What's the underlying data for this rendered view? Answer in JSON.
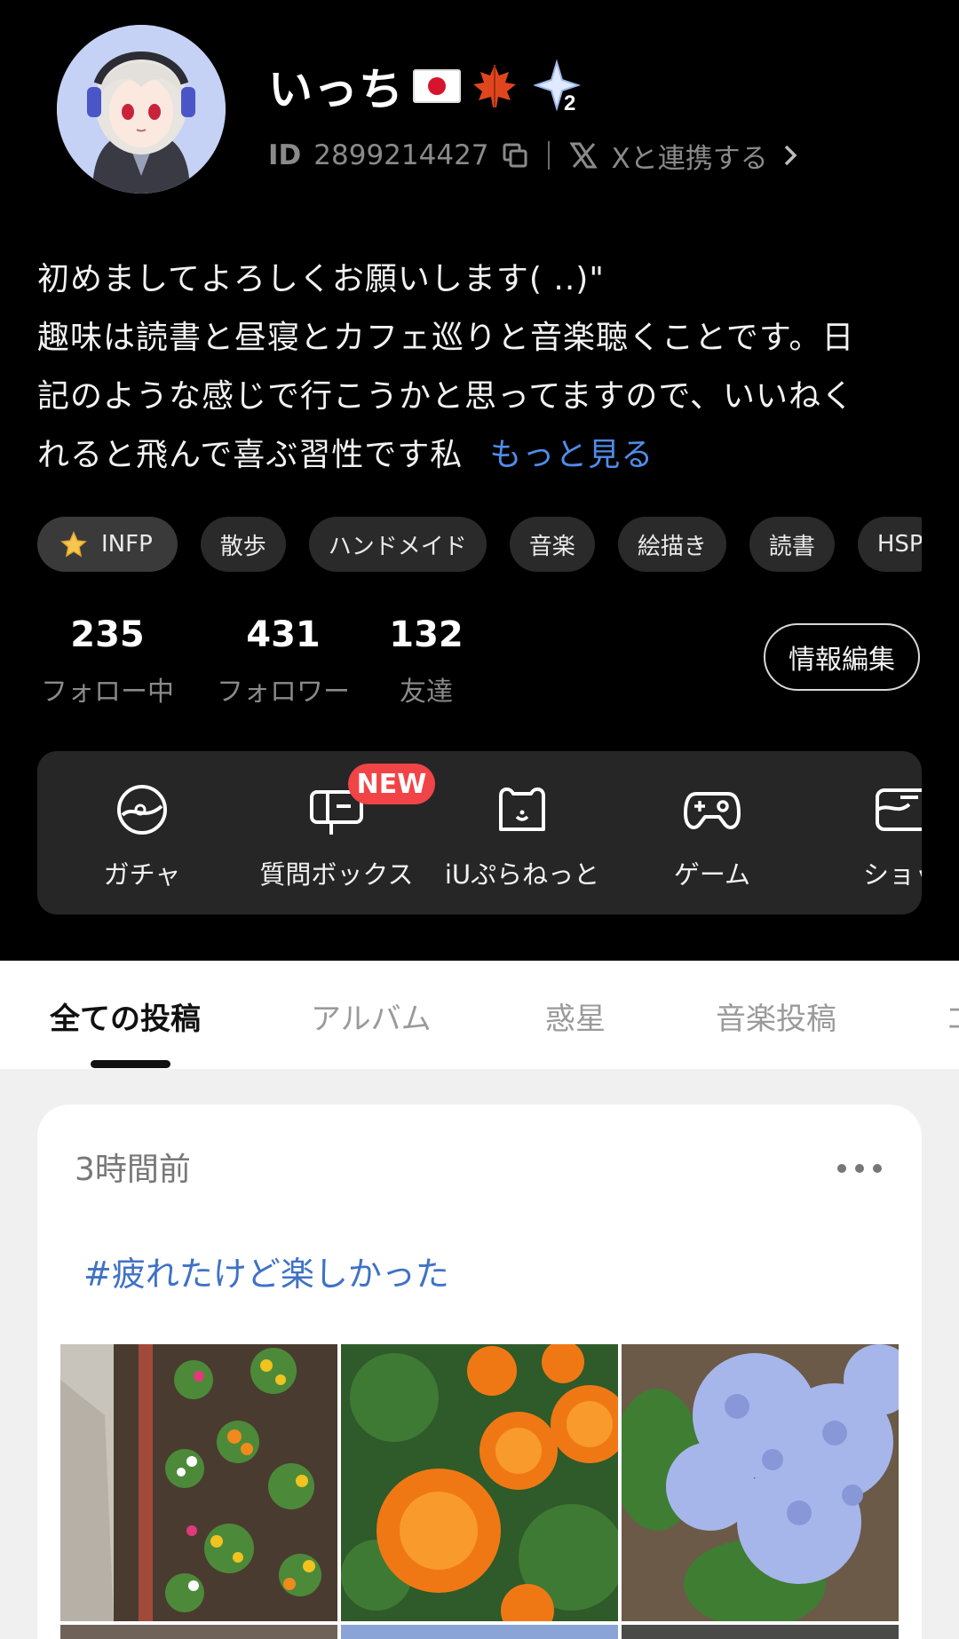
{
  "profile": {
    "username": "いっち",
    "id_label": "ID",
    "id_value": "2899214427",
    "x_link_label": "Xと連携する",
    "badge_level": "2",
    "bio_lines": [
      "初めましてよろしくお願いします( ..)\"",
      "趣味は読書と昼寝とカフェ巡りと音楽聴くことです。日",
      "記のような感じで行こうかと思ってますので、いいねく",
      "れると飛んで喜ぶ習性です私"
    ],
    "bio_more": "もっと見る"
  },
  "tags": [
    "INFP",
    "散歩",
    "ハンドメイド",
    "音楽",
    "絵描き",
    "読書",
    "HSP"
  ],
  "stats": {
    "following": {
      "value": "235",
      "label": "フォロー中"
    },
    "followers": {
      "value": "431",
      "label": "フォロワー"
    },
    "friends": {
      "value": "132",
      "label": "友達"
    },
    "edit_button": "情報編集"
  },
  "features": [
    {
      "label": "ガチャ",
      "icon": "gacha-icon"
    },
    {
      "label": "質問ボックス",
      "icon": "question-box-icon",
      "badge": "NEW"
    },
    {
      "label": "iUぷらねっと",
      "icon": "bear-icon"
    },
    {
      "label": "ゲーム",
      "icon": "gamepad-icon"
    },
    {
      "label": "ショッ",
      "icon": "shop-icon"
    }
  ],
  "tabs": [
    "全ての投稿",
    "アルバム",
    "惑星",
    "音楽投稿",
    "コ"
  ],
  "post": {
    "time": "3時間前",
    "hashtag": "#疲れたけど楽しかった"
  },
  "colors": {
    "accent_blue": "#4f8de8",
    "hashtag_blue": "#3f72c6",
    "new_badge": "#f04446"
  }
}
